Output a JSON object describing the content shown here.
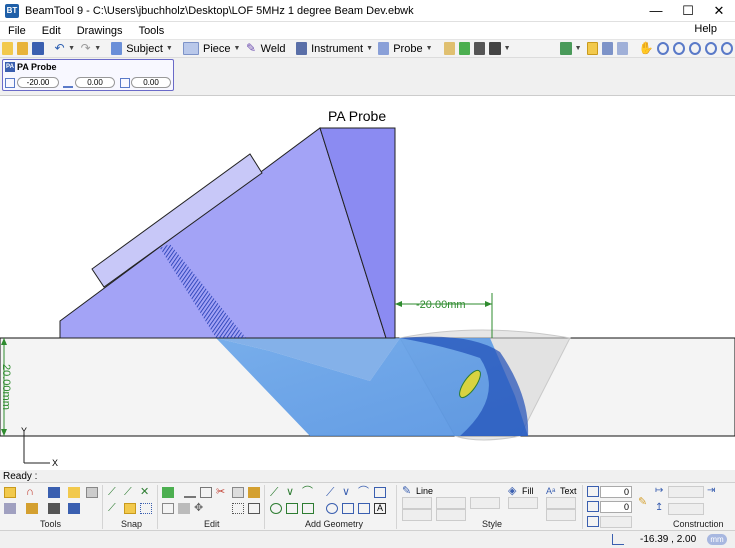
{
  "window": {
    "title": "BeamTool 9 - C:\\Users\\jbuchholz\\Desktop\\LOF 5MHz 1 degree Beam Dev.ebwk",
    "app_icon": "BT",
    "minimize": "—",
    "maximize": "☐",
    "close": "✕"
  },
  "menu": {
    "file": "File",
    "edit": "Edit",
    "drawings": "Drawings",
    "tools": "Tools",
    "help": "Help"
  },
  "toolbar": {
    "subject": "Subject",
    "piece": "Piece",
    "weld": "Weld",
    "instrument": "Instrument",
    "probe": "Probe"
  },
  "probe_panel": {
    "title": "PA Probe",
    "icon_text": "PA",
    "field_offset": "-20.00",
    "field_angle": "0.00",
    "field_skew": "0.00"
  },
  "canvas": {
    "probe_label": "PA Probe",
    "dimension_horizontal": "-20.00mm",
    "dimension_vertical": "20.00mm",
    "axis_y": "Y",
    "axis_x": "X",
    "colors": {
      "wedge": "#a3a3f6",
      "wedge_front": "#8b8bf2",
      "element": "#c8c8f8",
      "beam": "#3f86e0",
      "dimension": "#2e8b2e"
    }
  },
  "status": {
    "ready": "Ready :",
    "coords": "-16.39 , 2.00",
    "units": "mm"
  },
  "ribbon": {
    "groups": {
      "tools": "Tools",
      "snap": "Snap",
      "edit": "Edit",
      "add_geometry": "Add Geometry",
      "style": "Style",
      "construction_aid": "Construction Aid"
    },
    "style_line": "Line",
    "style_fill": "Fill",
    "style_text": "Text",
    "input_a": "0",
    "input_b": "0"
  }
}
